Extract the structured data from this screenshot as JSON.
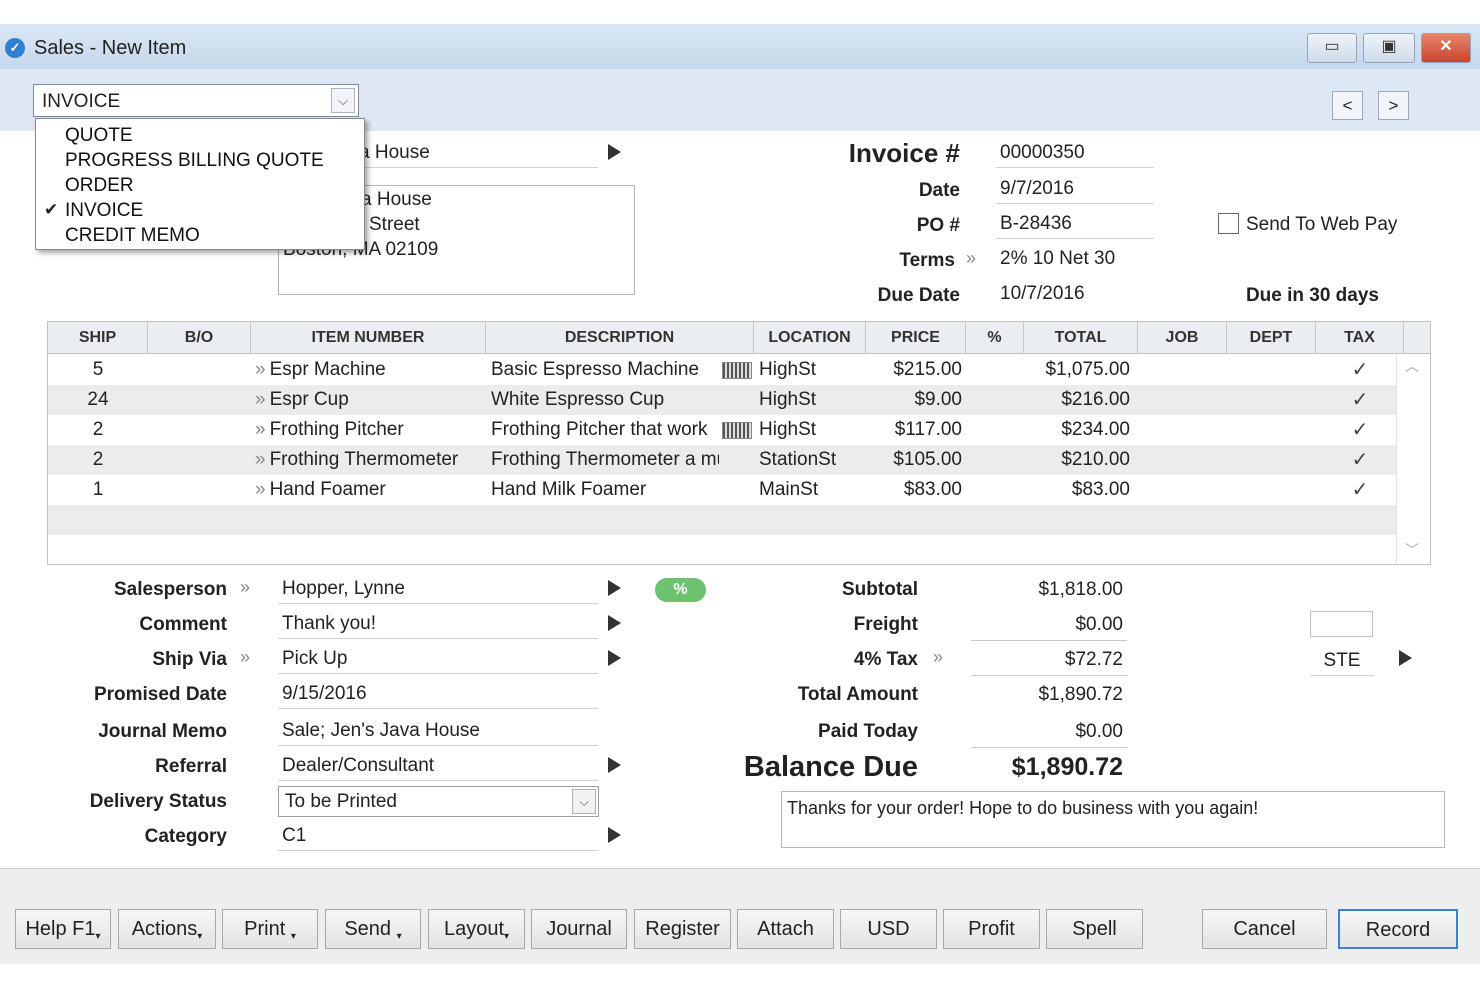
{
  "window": {
    "title": "Sales - New Item",
    "minimize": "▭",
    "maximize": "▣",
    "close": "✕"
  },
  "type_select": {
    "value": "INVOICE",
    "options": [
      "QUOTE",
      "PROGRESS BILLING QUOTE",
      "ORDER",
      "INVOICE",
      "CREDIT MEMO"
    ],
    "checked_option": "INVOICE",
    "check_mark": "✔"
  },
  "nav": {
    "prev": "<",
    "next": ">"
  },
  "customer": {
    "name_partial": "a House",
    "address_line1_partial": "a House",
    "address_line2_partial": "Street",
    "address_line3": "Boston, MA 02109"
  },
  "invoice": {
    "number_label": "Invoice #",
    "number": "00000350",
    "date_label": "Date",
    "date": "9/7/2016",
    "po_label": "PO #",
    "po": "B-28436",
    "terms_label": "Terms",
    "terms": "2% 10 Net 30",
    "due_label": "Due Date",
    "due": "10/7/2016",
    "due_in": "Due in 30 days",
    "send_web_pay": "Send To Web Pay"
  },
  "grid": {
    "columns": [
      "SHIP",
      "B/O",
      "ITEM NUMBER",
      "DESCRIPTION",
      "LOCATION",
      "PRICE",
      "%",
      "TOTAL",
      "JOB",
      "DEPT",
      "TAX"
    ],
    "rows": [
      {
        "ship": "5",
        "bo": "",
        "item": "Espr Machine",
        "description": "Basic Espresso Machine",
        "has_icon": true,
        "location": "HighSt",
        "price": "$215.00",
        "pct": "",
        "total": "$1,075.00",
        "job": "",
        "dept": "",
        "tax": "✓"
      },
      {
        "ship": "24",
        "bo": "",
        "item": "Espr Cup",
        "description": "White Espresso Cup",
        "has_icon": false,
        "location": "HighSt",
        "price": "$9.00",
        "pct": "",
        "total": "$216.00",
        "job": "",
        "dept": "",
        "tax": "✓"
      },
      {
        "ship": "2",
        "bo": "",
        "item": "Frothing Pitcher",
        "description": "Frothing Pitcher that work",
        "has_icon": true,
        "location": "HighSt",
        "price": "$117.00",
        "pct": "",
        "total": "$234.00",
        "job": "",
        "dept": "",
        "tax": "✓"
      },
      {
        "ship": "2",
        "bo": "",
        "item": "Frothing Thermometer",
        "description": "Frothing Thermometer a mus",
        "has_icon": false,
        "location": "StationSt",
        "price": "$105.00",
        "pct": "",
        "total": "$210.00",
        "job": "",
        "dept": "",
        "tax": "✓"
      },
      {
        "ship": "1",
        "bo": "",
        "item": "Hand Foamer",
        "description": "Hand Milk Foamer",
        "has_icon": false,
        "location": "MainSt",
        "price": "$83.00",
        "pct": "",
        "total": "$83.00",
        "job": "",
        "dept": "",
        "tax": "✓"
      }
    ],
    "link_glyph": "»",
    "scroll_up": "︿",
    "scroll_down": "﹀"
  },
  "details": {
    "salesperson_label": "Salesperson",
    "salesperson": "Hopper, Lynne",
    "comment_label": "Comment",
    "comment": "Thank you!",
    "ship_via_label": "Ship Via",
    "ship_via": "Pick Up",
    "promised_label": "Promised Date",
    "promised": "9/15/2016",
    "journal_label": "Journal Memo",
    "journal": "Sale; Jen's Java House",
    "referral_label": "Referral",
    "referral": "Dealer/Consultant",
    "delivery_label": "Delivery Status",
    "delivery": "To be Printed",
    "category_label": "Category",
    "category": "C1",
    "pct_pill": "%"
  },
  "totals": {
    "subtotal_label": "Subtotal",
    "subtotal": "$1,818.00",
    "freight_label": "Freight",
    "freight": "$0.00",
    "tax_label": "4% Tax",
    "tax": "$72.72",
    "total_label": "Total Amount",
    "total": "$1,890.72",
    "paid_label": "Paid Today",
    "paid": "$0.00",
    "balance_label": "Balance Due",
    "balance": "$1,890.72",
    "tax_code": "STE",
    "memo": "Thanks for your order! Hope to do business with you again!"
  },
  "buttons": {
    "help": "Help F1",
    "actions": "Actions",
    "print": "Print",
    "send": "Send",
    "layout": "Layout",
    "journal": "Journal",
    "register": "Register",
    "attach": "Attach",
    "usd": "USD",
    "profit": "Profit",
    "spell": "Spell",
    "cancel": "Cancel",
    "record": "Record",
    "caret": "▾"
  }
}
